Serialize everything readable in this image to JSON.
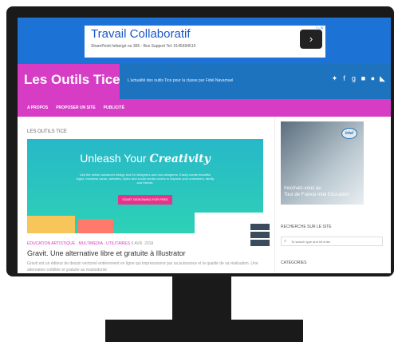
{
  "ad": {
    "title": "Travail Collaboratif",
    "subtitle": "SharePoint hébergé ou 365 - Box Support Tel: 0145694510",
    "button_icon": "chevron-right-icon",
    "adchoices_icon": "ad-choices-icon"
  },
  "header": {
    "site_name": "Les Outils Tice",
    "tagline": "L'actualité des outils Tice pour la classe par Fidel Navamuel",
    "social_icons": [
      "twitter-icon",
      "facebook-icon",
      "google-plus-icon",
      "linkedin-icon",
      "pinterest-icon",
      "rss-icon"
    ]
  },
  "nav": {
    "items": [
      "A PROPOS",
      "PROPOSER UN SITE",
      "PUBLICITÉ"
    ]
  },
  "main": {
    "breadcrumb": "LES OUTILS TICE",
    "hero": {
      "headline": "Unleash Your",
      "headline_accent": "Creativity",
      "description": "Use the online advanced design tool for designers and non-designers. Easily create beautiful logos, business cards, websites, flyers and social media covers to impress your customers, family and friends.",
      "button": "START DESIGNING FOR FREE"
    },
    "post": {
      "categories": "EDUCATION ARTISTIQUE · MULTIMEDIA · UTILITAIRES",
      "date": "6 AVR. 2018",
      "title": "Gravit. Une alternative libre et gratuite à Illustrator",
      "excerpt": "Gravit est un éditeur de dessin vectoriel entièrement en ligne qui impressionne par sa puissance et la qualité de sa réalisation. Une alternative crédible et gratuite au mastodonte"
    }
  },
  "sidebar": {
    "promo": {
      "badge": "intel",
      "line1": "Inscrivez-vous au",
      "line2": "Tour de France Intel Education"
    },
    "search": {
      "title": "RECHERCHE SUR LE SITE",
      "placeholder": "To search type and hit enter"
    },
    "categories_title": "CATÉGORIES"
  },
  "colors": {
    "blue": "#1e73be",
    "magenta": "#d63cc4",
    "monitor": "#1a1a1a"
  }
}
